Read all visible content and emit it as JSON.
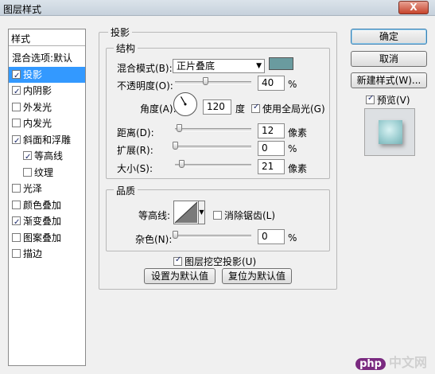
{
  "window": {
    "title": "图层样式",
    "close_label": "X"
  },
  "left_panel": {
    "header": "样式",
    "items": [
      {
        "label": "混合选项:默认",
        "has_checkbox": false,
        "checked": false,
        "selected": false,
        "indent": false
      },
      {
        "label": "投影",
        "has_checkbox": true,
        "checked": true,
        "selected": true,
        "indent": false
      },
      {
        "label": "内阴影",
        "has_checkbox": true,
        "checked": true,
        "selected": false,
        "indent": false
      },
      {
        "label": "外发光",
        "has_checkbox": true,
        "checked": false,
        "selected": false,
        "indent": false
      },
      {
        "label": "内发光",
        "has_checkbox": true,
        "checked": false,
        "selected": false,
        "indent": false
      },
      {
        "label": "斜面和浮雕",
        "has_checkbox": true,
        "checked": true,
        "selected": false,
        "indent": false
      },
      {
        "label": "等高线",
        "has_checkbox": true,
        "checked": true,
        "selected": false,
        "indent": true
      },
      {
        "label": "纹理",
        "has_checkbox": true,
        "checked": false,
        "selected": false,
        "indent": true
      },
      {
        "label": "光泽",
        "has_checkbox": true,
        "checked": false,
        "selected": false,
        "indent": false
      },
      {
        "label": "颜色叠加",
        "has_checkbox": true,
        "checked": false,
        "selected": false,
        "indent": false
      },
      {
        "label": "渐变叠加",
        "has_checkbox": true,
        "checked": true,
        "selected": false,
        "indent": false
      },
      {
        "label": "图案叠加",
        "has_checkbox": true,
        "checked": false,
        "selected": false,
        "indent": false
      },
      {
        "label": "描边",
        "has_checkbox": true,
        "checked": false,
        "selected": false,
        "indent": false
      }
    ]
  },
  "drop_shadow": {
    "title": "投影",
    "structure": {
      "title": "结构",
      "blend_mode_label": "混合模式(B):",
      "blend_mode_value": "正片叠底",
      "shadow_color": "#6a9b9f",
      "opacity_label": "不透明度(O):",
      "opacity_value": "40",
      "opacity_fraction": 0.4,
      "percent": "%",
      "angle_label": "角度(A):",
      "angle_value": "120",
      "angle_unit": "度",
      "global_light_label": "使用全局光(G)",
      "global_light_checked": true,
      "distance_label": "距离(D):",
      "distance_value": "12",
      "distance_unit": "像素",
      "distance_fraction": 0.05,
      "spread_label": "扩展(R):",
      "spread_value": "0",
      "spread_fraction": 0.0,
      "size_label": "大小(S):",
      "size_value": "21",
      "size_unit": "像素",
      "size_fraction": 0.08
    },
    "quality": {
      "title": "品质",
      "contour_label": "等高线:",
      "anti_alias_label": "消除锯齿(L)",
      "anti_alias_checked": false,
      "noise_label": "杂色(N):",
      "noise_value": "0",
      "noise_fraction": 0.0,
      "percent": "%"
    },
    "knockout_label": "图层挖空投影(U)",
    "knockout_checked": true,
    "make_default_label": "设置为默认值",
    "reset_default_label": "复位为默认值"
  },
  "right_panel": {
    "ok_label": "确定",
    "cancel_label": "取消",
    "new_style_label": "新建样式(W)...",
    "preview_label": "预览(V)",
    "preview_checked": true
  },
  "watermark": {
    "badge": "php",
    "text": "中文网"
  }
}
